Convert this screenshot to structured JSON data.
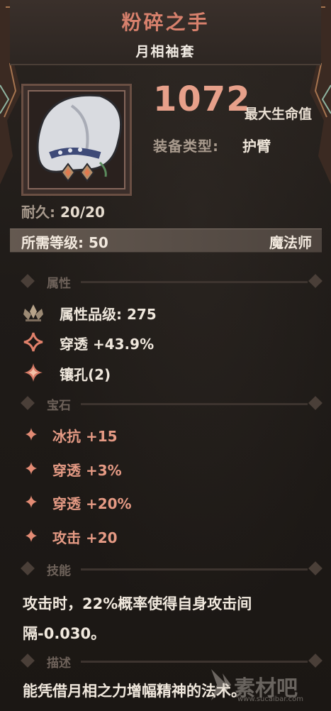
{
  "item": {
    "name": "粉碎之手",
    "subtitle": "月相袖套",
    "main_stat_value": "1072",
    "main_stat_label": "最大生命值",
    "equip_type_label": "装备类型:",
    "equip_type_value": "护臂",
    "durability_label": "耐久:",
    "durability_value": "20/20",
    "req_level_label": "所需等级: 50",
    "req_class": "魔法师"
  },
  "sections": {
    "attributes": "属性",
    "gems": "宝石",
    "skill": "技能",
    "description": "描述"
  },
  "attributes": [
    {
      "icon": "lotus-icon",
      "text": "属性品级: 275"
    },
    {
      "icon": "sparkle-icon",
      "text": "穿透 +43.9%"
    },
    {
      "icon": "socket-icon",
      "text": "镶孔(2)"
    }
  ],
  "gems": [
    {
      "text": "冰抗 +15"
    },
    {
      "text": "穿透 +3%"
    },
    {
      "text": "穿透 +20%"
    },
    {
      "text": "攻击 +20"
    }
  ],
  "skill_text": "攻击时，22%概率使得自身攻击间隔-0.030。",
  "description_text": "能凭借月相之力增幅精神的法术。",
  "watermark": {
    "text": "素材吧",
    "sub": "www.sucaibar.com"
  },
  "colors": {
    "title": "#d7806c",
    "stat": "#e7a08a",
    "gem": "#e59a84"
  }
}
